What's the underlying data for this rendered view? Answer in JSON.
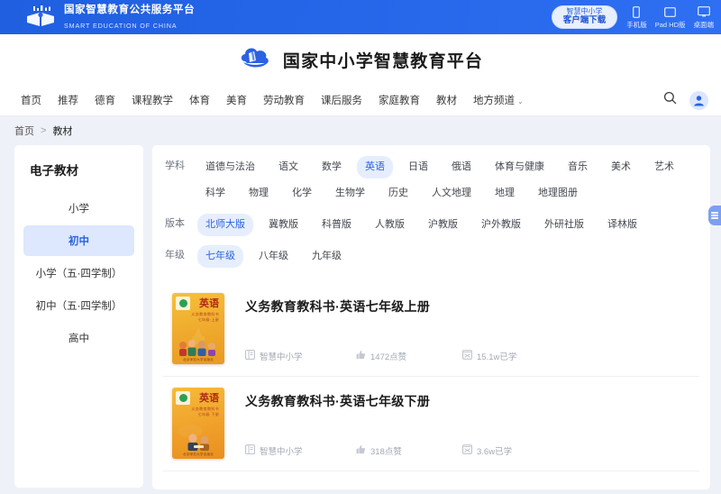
{
  "topbar": {
    "logo_cn": "国家智慧教育公共服务平台",
    "logo_en": "SMART EDUCATION OF CHINA",
    "logo_mark_name": "open-book-logo-icon",
    "download_line1": "智慧中小学",
    "download_line2": "客户端下载",
    "devices": [
      {
        "label": "手机版",
        "icon": "phone-icon"
      },
      {
        "label": "Pad HD版",
        "icon": "tablet-icon"
      },
      {
        "label": "桌面端",
        "icon": "desktop-icon"
      }
    ]
  },
  "brand": {
    "name": "国家中小学智慧教育平台",
    "mark": "cloud-book-icon"
  },
  "nav": {
    "items": [
      {
        "label": "首页"
      },
      {
        "label": "推荐"
      },
      {
        "label": "德育"
      },
      {
        "label": "课程教学"
      },
      {
        "label": "体育"
      },
      {
        "label": "美育"
      },
      {
        "label": "劳动教育"
      },
      {
        "label": "课后服务"
      },
      {
        "label": "家庭教育"
      },
      {
        "label": "教材"
      },
      {
        "label": "地方频道",
        "caret": "⌄"
      }
    ],
    "search_icon": "search-icon",
    "avatar_icon": "user-avatar-icon"
  },
  "breadcrumb": {
    "home": "首页",
    "separator": ">",
    "current": "教材"
  },
  "sidebar": {
    "title": "电子教材",
    "items": [
      {
        "label": "小学",
        "selected": false
      },
      {
        "label": "初中",
        "selected": true
      },
      {
        "label": "小学（五·四学制）",
        "selected": false
      },
      {
        "label": "初中（五·四学制）",
        "selected": false
      },
      {
        "label": "高中",
        "selected": false
      }
    ]
  },
  "filters": [
    {
      "label": "学科",
      "options": [
        {
          "text": "道德与法治",
          "selected": false
        },
        {
          "text": "语文",
          "selected": false
        },
        {
          "text": "数学",
          "selected": false
        },
        {
          "text": "英语",
          "selected": true
        },
        {
          "text": "日语",
          "selected": false
        },
        {
          "text": "俄语",
          "selected": false
        },
        {
          "text": "体育与健康",
          "selected": false
        },
        {
          "text": "音乐",
          "selected": false
        },
        {
          "text": "美术",
          "selected": false
        },
        {
          "text": "艺术",
          "selected": false
        },
        {
          "text": "科学",
          "selected": false
        },
        {
          "text": "物理",
          "selected": false
        },
        {
          "text": "化学",
          "selected": false
        },
        {
          "text": "生物学",
          "selected": false
        },
        {
          "text": "历史",
          "selected": false
        },
        {
          "text": "人文地理",
          "selected": false
        },
        {
          "text": "地理",
          "selected": false
        },
        {
          "text": "地理图册",
          "selected": false
        }
      ]
    },
    {
      "label": "版本",
      "options": [
        {
          "text": "北师大版",
          "selected": true
        },
        {
          "text": "冀教版",
          "selected": false
        },
        {
          "text": "科普版",
          "selected": false
        },
        {
          "text": "人教版",
          "selected": false
        },
        {
          "text": "沪教版",
          "selected": false
        },
        {
          "text": "沪外教版",
          "selected": false
        },
        {
          "text": "外研社版",
          "selected": false
        },
        {
          "text": "译林版",
          "selected": false
        }
      ]
    },
    {
      "label": "年级",
      "options": [
        {
          "text": "七年级",
          "selected": true
        },
        {
          "text": "八年级",
          "selected": false
        },
        {
          "text": "九年级",
          "selected": false
        }
      ]
    }
  ],
  "books": [
    {
      "title": "义务教育教科书·英语七年级上册",
      "cover_title": "英语",
      "cover_sub": "义务教育教科书\n七年级·上册",
      "cover_publisher": "北京师范大学出版社",
      "publisher_label": "智慧中小学",
      "likes": "1472点赞",
      "learners": "15.1w已学",
      "publisher_icon": "institution-icon",
      "likes_icon": "thumbs-up-icon",
      "learners_icon": "study-book-icon"
    },
    {
      "title": "义务教育教科书·英语七年级下册",
      "cover_title": "英语",
      "cover_sub": "义务教育教科书\n七年级·下册",
      "cover_publisher": "北京师范大学出版社",
      "publisher_label": "智慧中小学",
      "likes": "318点赞",
      "learners": "3.6w已学",
      "publisher_icon": "institution-icon",
      "likes_icon": "thumbs-up-icon",
      "learners_icon": "study-book-icon"
    }
  ],
  "float_tab": {
    "icon": "side-panel-toggle-icon"
  },
  "colors": {
    "banner_blue": "#2565e8",
    "accent_blue": "#2a62e0",
    "chip_selected_bg": "#e6eefe",
    "sidebar_selected_bg": "#dde7fd",
    "page_bg": "#eef1f8",
    "cover_orange": "#efa92c"
  }
}
